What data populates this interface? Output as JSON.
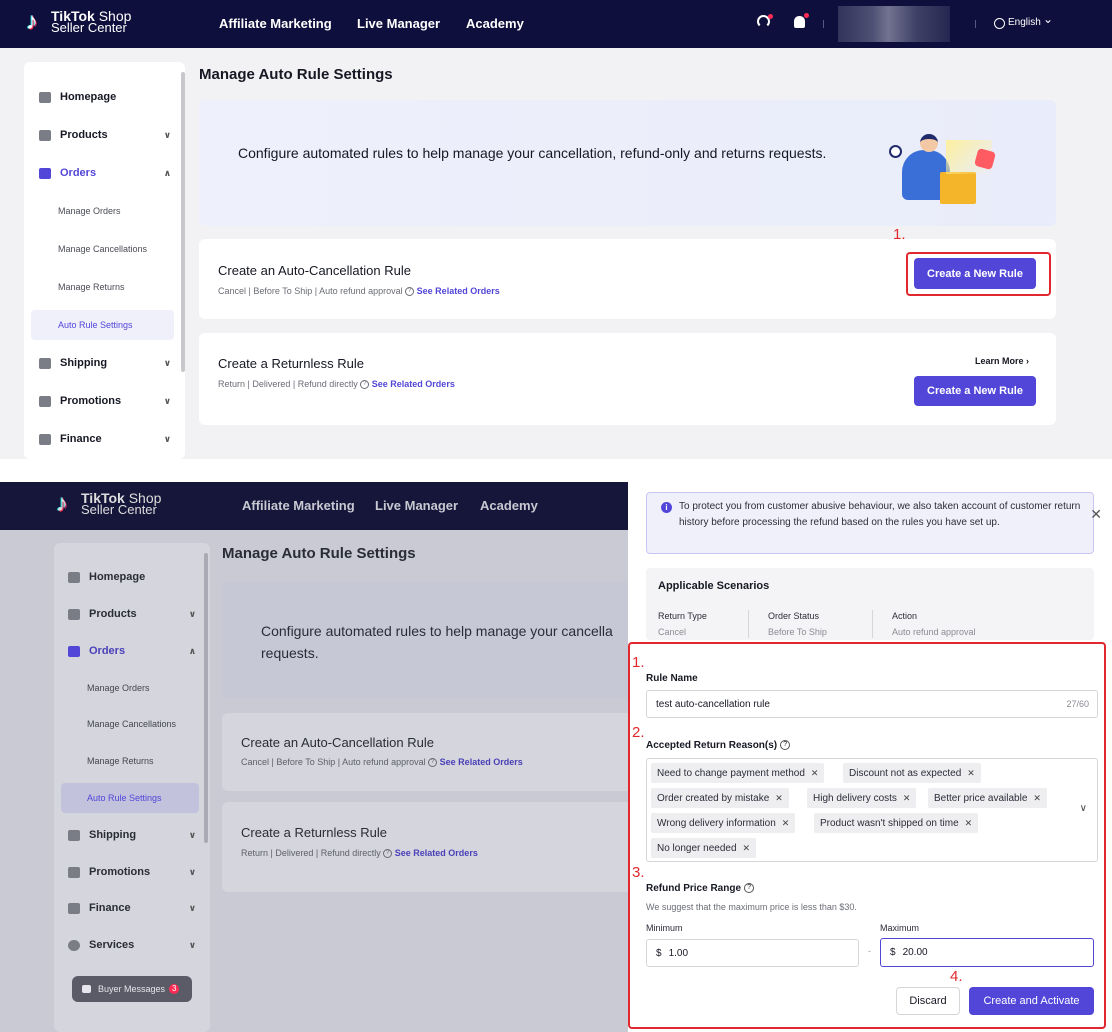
{
  "brand": {
    "name_bold": "TikTok",
    "name_light": " Shop",
    "subtitle": "Seller Center"
  },
  "nav": [
    "Affiliate Marketing",
    "Live Manager",
    "Academy"
  ],
  "header_right": {
    "language": "English",
    "language_chevron": "⌄"
  },
  "page_title": "Manage Auto Rule Settings",
  "sidebar": {
    "items": [
      {
        "label": "Homepage"
      },
      {
        "label": "Products"
      },
      {
        "label": "Orders"
      },
      {
        "label": "Shipping"
      },
      {
        "label": "Promotions"
      },
      {
        "label": "Finance"
      },
      {
        "label": "Services"
      }
    ],
    "order_subitems": [
      "Manage Orders",
      "Manage Cancellations",
      "Manage Returns",
      "Auto Rule Settings"
    ],
    "buyer_messages": {
      "label": "Buyer Messages",
      "count": "3"
    }
  },
  "banner": {
    "text": "Configure automated rules to help manage your cancellation, refund-only and returns requests.",
    "text_truncated": "Configure automated rules to help manage your cancella",
    "text_line2": "requests."
  },
  "cards": {
    "auto_cancel": {
      "title": "Create an Auto-Cancellation Rule",
      "subtitle": "Cancel | Before To Ship | Auto refund approval",
      "link": "See Related Orders",
      "button": "Create a New Rule"
    },
    "returnless": {
      "title": "Create a Returnless Rule",
      "subtitle": "Return | Delivered | Refund directly",
      "link": "See Related Orders",
      "learn_more": "Learn More",
      "button": "Create a New Rule"
    }
  },
  "steps": {
    "s1": "1.",
    "s2": "2.",
    "s3": "3.",
    "s4": "4."
  },
  "drawer": {
    "notice": "To protect you from customer abusive behaviour, we also taken account of customer return history before processing the refund based on the rules you have set up.",
    "scenarios": {
      "title": "Applicable Scenarios",
      "columns": [
        {
          "key": "Return Type",
          "value": "Cancel"
        },
        {
          "key": "Order Status",
          "value": "Before To Ship"
        },
        {
          "key": "Action",
          "value": "Auto refund approval"
        }
      ]
    },
    "rule_name": {
      "label": "Rule Name",
      "value": "test auto-cancellation rule",
      "counter": "27/60"
    },
    "reasons": {
      "label": "Accepted Return Reason(s)",
      "tags": [
        "Need to change payment method",
        "Discount not as expected",
        "Order created by mistake",
        "High delivery costs",
        "Better price available",
        "Wrong delivery information",
        "Product wasn't shipped on time",
        "No longer needed"
      ]
    },
    "price_range": {
      "label": "Refund Price Range",
      "hint": "We suggest that the maximum price is less than $30.",
      "min_label": "Minimum",
      "max_label": "Maximum",
      "currency": "$",
      "min_value": "1.00",
      "max_value": "20.00",
      "separator": "-"
    },
    "discard": "Discard",
    "create": "Create and Activate"
  }
}
